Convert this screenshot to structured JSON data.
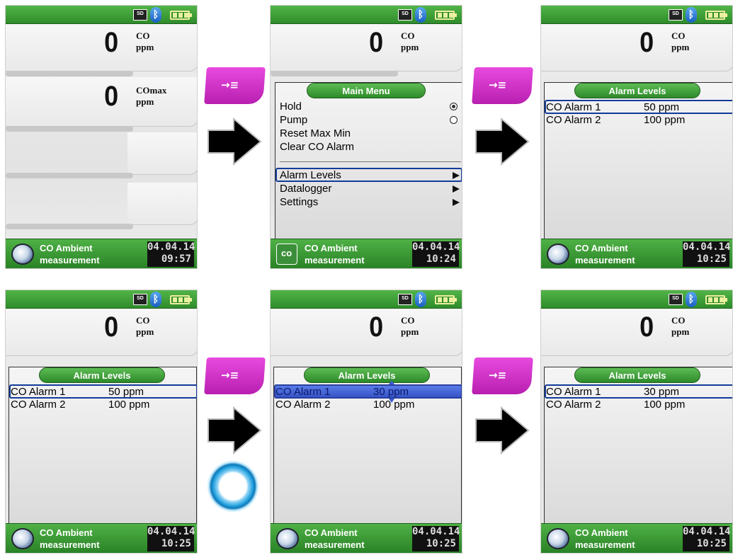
{
  "screens": [
    {
      "id": "s1",
      "readings": [
        {
          "value": "0",
          "gas": "CO",
          "unit": "ppm"
        },
        {
          "value": "0",
          "gas": "COmax",
          "unit": "ppm"
        }
      ],
      "status": {
        "line1": "CO Ambient",
        "line2": "measurement",
        "date": "04.04.14",
        "time": "09:57"
      }
    },
    {
      "id": "s2",
      "readings": [
        {
          "value": "0",
          "gas": "CO",
          "unit": "ppm"
        }
      ],
      "menu": {
        "title": "Main Menu",
        "items": [
          "Hold",
          "Pump",
          "Reset Max Min",
          "Clear CO Alarm"
        ],
        "sub_items": [
          "Alarm Levels",
          "Datalogger",
          "Settings"
        ]
      },
      "status": {
        "line1": "CO Ambient",
        "line2": "measurement",
        "date": "04.04.14",
        "time": "10:24"
      }
    },
    {
      "id": "s3",
      "readings": [
        {
          "value": "0",
          "gas": "CO",
          "unit": "ppm"
        }
      ],
      "panel": {
        "title": "Alarm Levels",
        "rows": [
          {
            "label": "CO Alarm 1",
            "value": "50 ppm"
          },
          {
            "label": "CO Alarm 2",
            "value": "100 ppm"
          }
        ]
      },
      "status": {
        "line1": "CO Ambient",
        "line2": "measurement",
        "date": "04.04.14",
        "time": "10:25"
      }
    },
    {
      "id": "s4",
      "readings": [
        {
          "value": "0",
          "gas": "CO",
          "unit": "ppm"
        }
      ],
      "panel": {
        "title": "Alarm Levels",
        "rows": [
          {
            "label": "CO Alarm 1",
            "value": "50 ppm"
          },
          {
            "label": "CO Alarm 2",
            "value": "100 ppm"
          }
        ]
      },
      "status": {
        "line1": "CO Ambient",
        "line2": "measurement",
        "date": "04.04.14",
        "time": "10:25"
      }
    },
    {
      "id": "s5",
      "readings": [
        {
          "value": "0",
          "gas": "CO",
          "unit": "ppm"
        }
      ],
      "panel": {
        "title": "Alarm Levels",
        "rows": [
          {
            "label": "CO Alarm 1",
            "value": "30 ppm"
          },
          {
            "label": "CO Alarm 2",
            "value": "100 ppm"
          }
        ]
      },
      "status": {
        "line1": "CO Ambient",
        "line2": "measurement",
        "date": "04.04.14",
        "time": "10:25"
      }
    },
    {
      "id": "s6",
      "readings": [
        {
          "value": "0",
          "gas": "CO",
          "unit": "ppm"
        }
      ],
      "panel": {
        "title": "Alarm Levels",
        "rows": [
          {
            "label": "CO Alarm 1",
            "value": "30 ppm"
          },
          {
            "label": "CO Alarm 2",
            "value": "100 ppm"
          }
        ]
      },
      "status": {
        "line1": "CO Ambient",
        "line2": "measurement",
        "date": "04.04.14",
        "time": "10:25"
      }
    }
  ],
  "icons": {
    "sd": "SD",
    "bluetooth": "bluetooth-icon",
    "battery": "battery-icon",
    "menu_key": "menu-key-icon",
    "next_arrow": "right-arrow-icon",
    "ring": "ring-button-icon"
  },
  "colors": {
    "status_green": "#3a9a34",
    "menu_key_magenta": "#d535cc",
    "selection_blue": "#123b9a"
  }
}
